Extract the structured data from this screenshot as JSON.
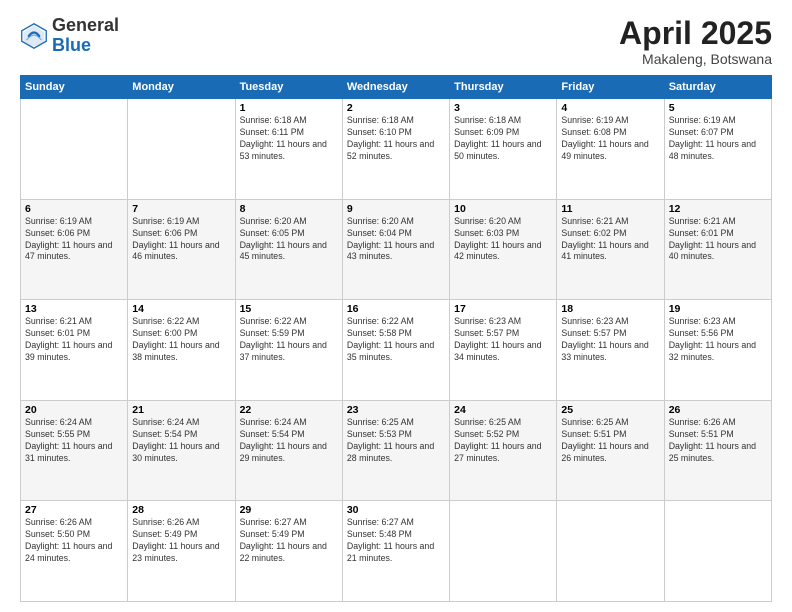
{
  "header": {
    "logo_general": "General",
    "logo_blue": "Blue",
    "month_title": "April 2025",
    "location": "Makaleng, Botswana"
  },
  "days_of_week": [
    "Sunday",
    "Monday",
    "Tuesday",
    "Wednesday",
    "Thursday",
    "Friday",
    "Saturday"
  ],
  "weeks": [
    [
      {
        "day": "",
        "sunrise": "",
        "sunset": "",
        "daylight": ""
      },
      {
        "day": "",
        "sunrise": "",
        "sunset": "",
        "daylight": ""
      },
      {
        "day": "1",
        "sunrise": "Sunrise: 6:18 AM",
        "sunset": "Sunset: 6:11 PM",
        "daylight": "Daylight: 11 hours and 53 minutes."
      },
      {
        "day": "2",
        "sunrise": "Sunrise: 6:18 AM",
        "sunset": "Sunset: 6:10 PM",
        "daylight": "Daylight: 11 hours and 52 minutes."
      },
      {
        "day": "3",
        "sunrise": "Sunrise: 6:18 AM",
        "sunset": "Sunset: 6:09 PM",
        "daylight": "Daylight: 11 hours and 50 minutes."
      },
      {
        "day": "4",
        "sunrise": "Sunrise: 6:19 AM",
        "sunset": "Sunset: 6:08 PM",
        "daylight": "Daylight: 11 hours and 49 minutes."
      },
      {
        "day": "5",
        "sunrise": "Sunrise: 6:19 AM",
        "sunset": "Sunset: 6:07 PM",
        "daylight": "Daylight: 11 hours and 48 minutes."
      }
    ],
    [
      {
        "day": "6",
        "sunrise": "Sunrise: 6:19 AM",
        "sunset": "Sunset: 6:06 PM",
        "daylight": "Daylight: 11 hours and 47 minutes."
      },
      {
        "day": "7",
        "sunrise": "Sunrise: 6:19 AM",
        "sunset": "Sunset: 6:06 PM",
        "daylight": "Daylight: 11 hours and 46 minutes."
      },
      {
        "day": "8",
        "sunrise": "Sunrise: 6:20 AM",
        "sunset": "Sunset: 6:05 PM",
        "daylight": "Daylight: 11 hours and 45 minutes."
      },
      {
        "day": "9",
        "sunrise": "Sunrise: 6:20 AM",
        "sunset": "Sunset: 6:04 PM",
        "daylight": "Daylight: 11 hours and 43 minutes."
      },
      {
        "day": "10",
        "sunrise": "Sunrise: 6:20 AM",
        "sunset": "Sunset: 6:03 PM",
        "daylight": "Daylight: 11 hours and 42 minutes."
      },
      {
        "day": "11",
        "sunrise": "Sunrise: 6:21 AM",
        "sunset": "Sunset: 6:02 PM",
        "daylight": "Daylight: 11 hours and 41 minutes."
      },
      {
        "day": "12",
        "sunrise": "Sunrise: 6:21 AM",
        "sunset": "Sunset: 6:01 PM",
        "daylight": "Daylight: 11 hours and 40 minutes."
      }
    ],
    [
      {
        "day": "13",
        "sunrise": "Sunrise: 6:21 AM",
        "sunset": "Sunset: 6:01 PM",
        "daylight": "Daylight: 11 hours and 39 minutes."
      },
      {
        "day": "14",
        "sunrise": "Sunrise: 6:22 AM",
        "sunset": "Sunset: 6:00 PM",
        "daylight": "Daylight: 11 hours and 38 minutes."
      },
      {
        "day": "15",
        "sunrise": "Sunrise: 6:22 AM",
        "sunset": "Sunset: 5:59 PM",
        "daylight": "Daylight: 11 hours and 37 minutes."
      },
      {
        "day": "16",
        "sunrise": "Sunrise: 6:22 AM",
        "sunset": "Sunset: 5:58 PM",
        "daylight": "Daylight: 11 hours and 35 minutes."
      },
      {
        "day": "17",
        "sunrise": "Sunrise: 6:23 AM",
        "sunset": "Sunset: 5:57 PM",
        "daylight": "Daylight: 11 hours and 34 minutes."
      },
      {
        "day": "18",
        "sunrise": "Sunrise: 6:23 AM",
        "sunset": "Sunset: 5:57 PM",
        "daylight": "Daylight: 11 hours and 33 minutes."
      },
      {
        "day": "19",
        "sunrise": "Sunrise: 6:23 AM",
        "sunset": "Sunset: 5:56 PM",
        "daylight": "Daylight: 11 hours and 32 minutes."
      }
    ],
    [
      {
        "day": "20",
        "sunrise": "Sunrise: 6:24 AM",
        "sunset": "Sunset: 5:55 PM",
        "daylight": "Daylight: 11 hours and 31 minutes."
      },
      {
        "day": "21",
        "sunrise": "Sunrise: 6:24 AM",
        "sunset": "Sunset: 5:54 PM",
        "daylight": "Daylight: 11 hours and 30 minutes."
      },
      {
        "day": "22",
        "sunrise": "Sunrise: 6:24 AM",
        "sunset": "Sunset: 5:54 PM",
        "daylight": "Daylight: 11 hours and 29 minutes."
      },
      {
        "day": "23",
        "sunrise": "Sunrise: 6:25 AM",
        "sunset": "Sunset: 5:53 PM",
        "daylight": "Daylight: 11 hours and 28 minutes."
      },
      {
        "day": "24",
        "sunrise": "Sunrise: 6:25 AM",
        "sunset": "Sunset: 5:52 PM",
        "daylight": "Daylight: 11 hours and 27 minutes."
      },
      {
        "day": "25",
        "sunrise": "Sunrise: 6:25 AM",
        "sunset": "Sunset: 5:51 PM",
        "daylight": "Daylight: 11 hours and 26 minutes."
      },
      {
        "day": "26",
        "sunrise": "Sunrise: 6:26 AM",
        "sunset": "Sunset: 5:51 PM",
        "daylight": "Daylight: 11 hours and 25 minutes."
      }
    ],
    [
      {
        "day": "27",
        "sunrise": "Sunrise: 6:26 AM",
        "sunset": "Sunset: 5:50 PM",
        "daylight": "Daylight: 11 hours and 24 minutes."
      },
      {
        "day": "28",
        "sunrise": "Sunrise: 6:26 AM",
        "sunset": "Sunset: 5:49 PM",
        "daylight": "Daylight: 11 hours and 23 minutes."
      },
      {
        "day": "29",
        "sunrise": "Sunrise: 6:27 AM",
        "sunset": "Sunset: 5:49 PM",
        "daylight": "Daylight: 11 hours and 22 minutes."
      },
      {
        "day": "30",
        "sunrise": "Sunrise: 6:27 AM",
        "sunset": "Sunset: 5:48 PM",
        "daylight": "Daylight: 11 hours and 21 minutes."
      },
      {
        "day": "",
        "sunrise": "",
        "sunset": "",
        "daylight": ""
      },
      {
        "day": "",
        "sunrise": "",
        "sunset": "",
        "daylight": ""
      },
      {
        "day": "",
        "sunrise": "",
        "sunset": "",
        "daylight": ""
      }
    ]
  ]
}
